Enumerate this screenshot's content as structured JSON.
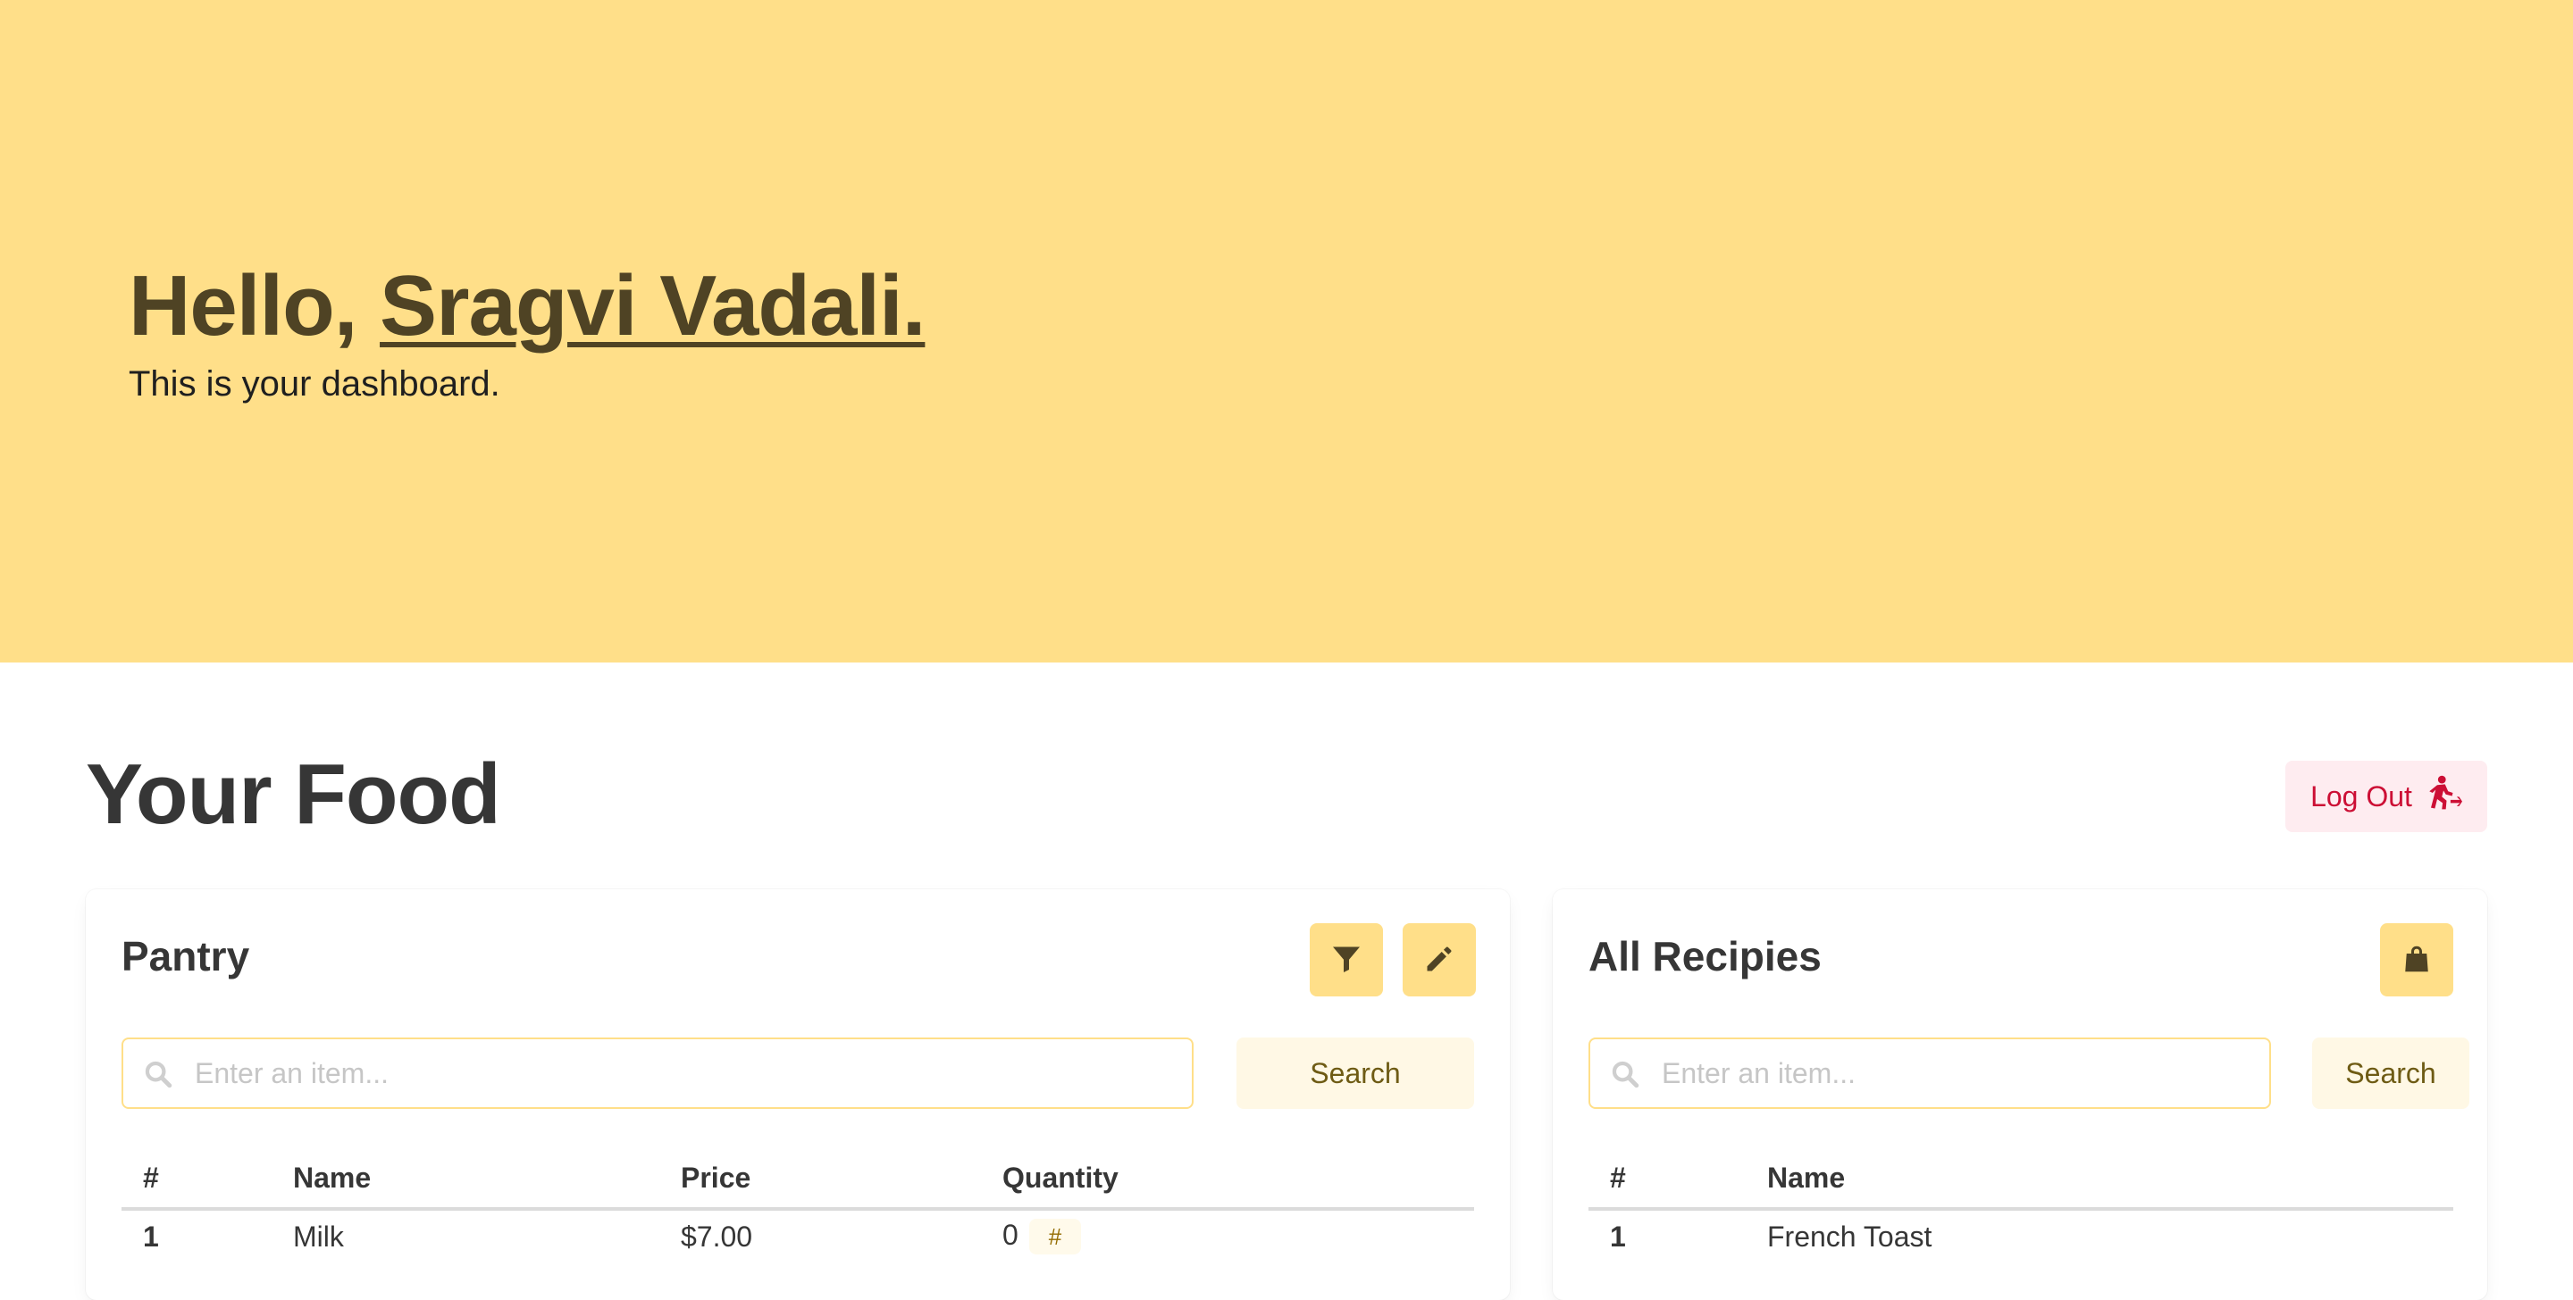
{
  "hero": {
    "greeting": "Hello,",
    "user_name": "Sragvi Vadali.",
    "subtitle": "This is your dashboard."
  },
  "section": {
    "title": "Your Food",
    "logout_label": "Log Out"
  },
  "pantry": {
    "title": "Pantry",
    "search_placeholder": "Enter an item...",
    "search_label": "Search",
    "columns": [
      "#",
      "Name",
      "Price",
      "Quantity"
    ],
    "rows": [
      {
        "index": "1",
        "name": "Milk",
        "price": "$7.00",
        "quantity": "0",
        "tag": "#"
      }
    ]
  },
  "recipes": {
    "title": "All Recipies",
    "search_placeholder": "Enter an item...",
    "search_label": "Search",
    "columns": [
      "#",
      "Name"
    ],
    "rows": [
      {
        "index": "1",
        "name": "French Toast"
      }
    ]
  },
  "icons": {
    "filter": "filter-icon",
    "edit": "pencil-icon",
    "bag": "shopping-bag-icon",
    "logout": "running-exit-icon",
    "search": "search-icon"
  },
  "colors": {
    "hero_background": "#ffdf89",
    "accent": "#ffdf89",
    "hero_title": "#4f4324",
    "danger": "#cc0f35",
    "danger_light": "#feecf0",
    "search_button_bg": "#fff8e5"
  }
}
